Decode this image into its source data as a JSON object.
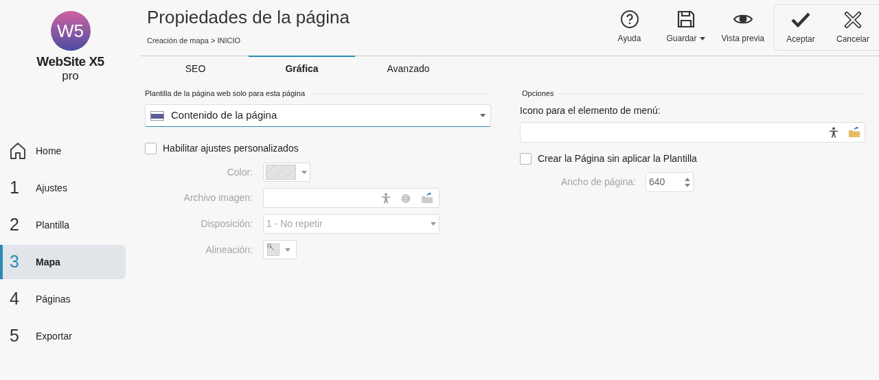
{
  "logo": {
    "mark": "W5",
    "name": "WebSite X5",
    "edition": "pro"
  },
  "sidebar": {
    "items": [
      {
        "kind": "home",
        "label": "Home",
        "selected": false
      },
      {
        "kind": "step",
        "number": "1",
        "label": "Ajustes",
        "selected": false
      },
      {
        "kind": "step",
        "number": "2",
        "label": "Plantilla",
        "selected": false
      },
      {
        "kind": "step",
        "number": "3",
        "label": "Mapa",
        "selected": true
      },
      {
        "kind": "step",
        "number": "4",
        "label": "Páginas",
        "selected": false
      },
      {
        "kind": "step",
        "number": "5",
        "label": "Exportar",
        "selected": false
      }
    ]
  },
  "header": {
    "title": "Propiedades de la página",
    "breadcrumb": "Creación de mapa > INICIO"
  },
  "toolbar": {
    "main": [
      {
        "kind": "help",
        "label": "Ayuda",
        "dropdown": false
      },
      {
        "kind": "save",
        "label": "Guardar",
        "dropdown": true
      },
      {
        "kind": "preview",
        "label": "Vista previa",
        "dropdown": false
      }
    ],
    "confirm": [
      {
        "kind": "accept",
        "label": "Aceptar",
        "dropdown": false
      },
      {
        "kind": "cancel",
        "label": "Cancelar",
        "dropdown": false
      }
    ]
  },
  "tabs": [
    {
      "label": "SEO",
      "selected": false
    },
    {
      "label": "Gráfica",
      "selected": true
    },
    {
      "label": "Avanzado",
      "selected": false
    }
  ],
  "template": {
    "section": "Plantilla de la página web solo para esta página",
    "value": "Contenido de la página",
    "custom": {
      "label": "Habilitar ajustes personalizados",
      "checked": false
    },
    "color_label": "Color:",
    "image_label": "Archivo imagen:",
    "layout_label": "Disposición:",
    "layout_value": "1 - No repetir",
    "align_label": "Alineación:"
  },
  "options": {
    "section": "Opciones",
    "icon_label": "Icono para el elemento de menú:",
    "no_template": {
      "label": "Crear la Página sin aplicar la Plantilla",
      "checked": false
    },
    "width_label": "Ancho de página:",
    "width_value": "640"
  }
}
